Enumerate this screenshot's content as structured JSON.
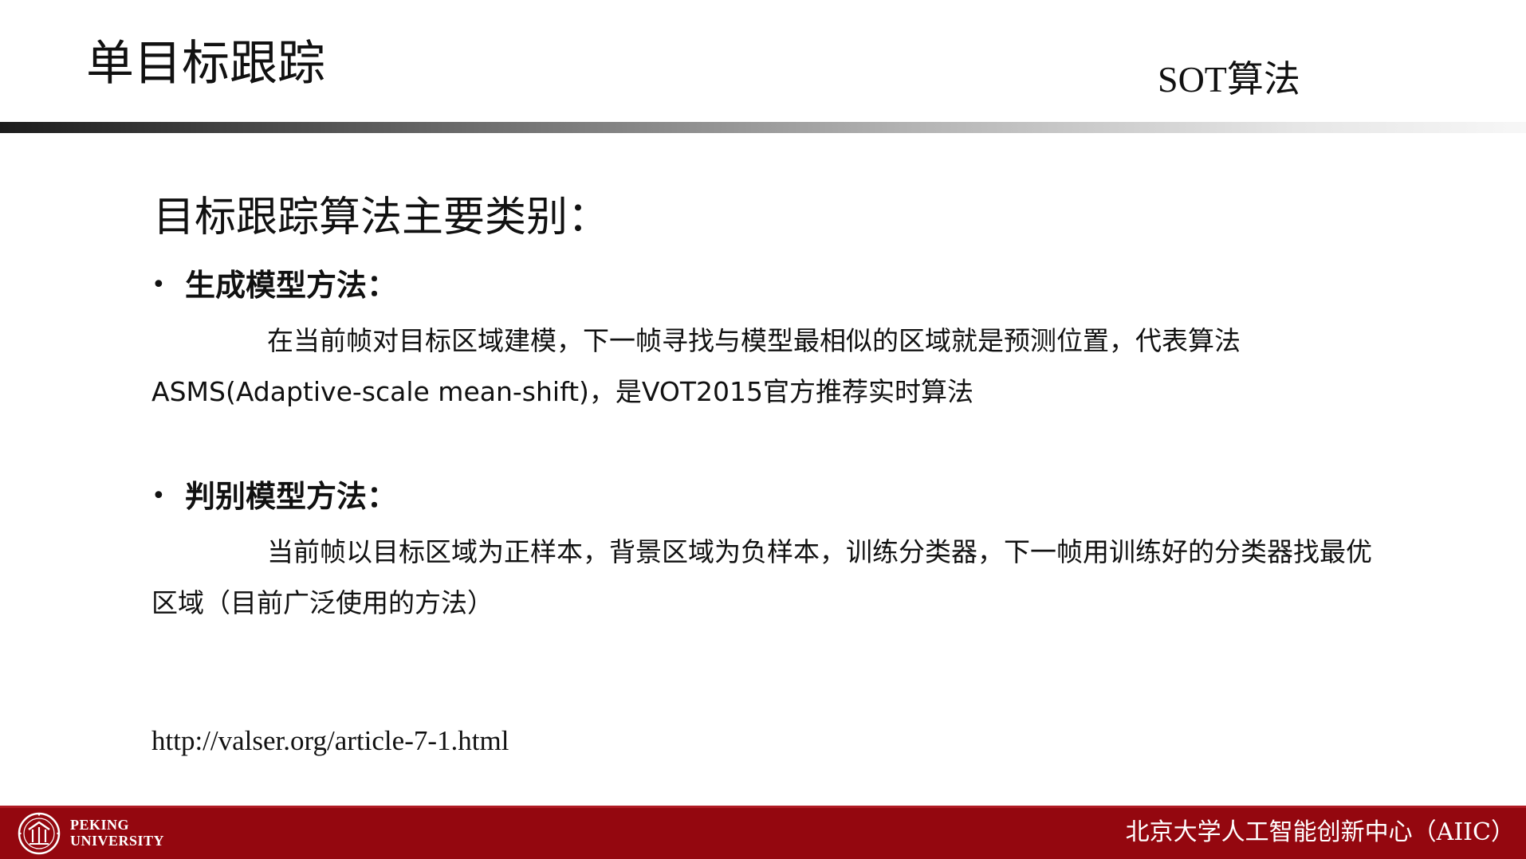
{
  "header": {
    "title": "单目标跟踪",
    "section_label": "SOT算法"
  },
  "main": {
    "heading": "目标跟踪算法主要类别：",
    "categories": [
      {
        "bullet": "•",
        "title": "生成模型方法：",
        "description": "在当前帧对目标区域建模，下一帧寻找与模型最相似的区域就是预测位置，代表算法ASMS(Adaptive-scale mean-shift)，是VOT2015官方推荐实时算法"
      },
      {
        "bullet": "•",
        "title": "判别模型方法：",
        "description": "当前帧以目标区域为正样本，背景区域为负样本，训练分类器，下一帧用训练好的分类器找最优区域（目前广泛使用的方法）"
      }
    ],
    "source_link": "http://valser.org/article-7-1.html"
  },
  "footer": {
    "logo_line1": "PEKING",
    "logo_line2": "UNIVERSITY",
    "organization": "北京大学人工智能创新中心（AIIC）",
    "bar_color": "#94070f"
  }
}
